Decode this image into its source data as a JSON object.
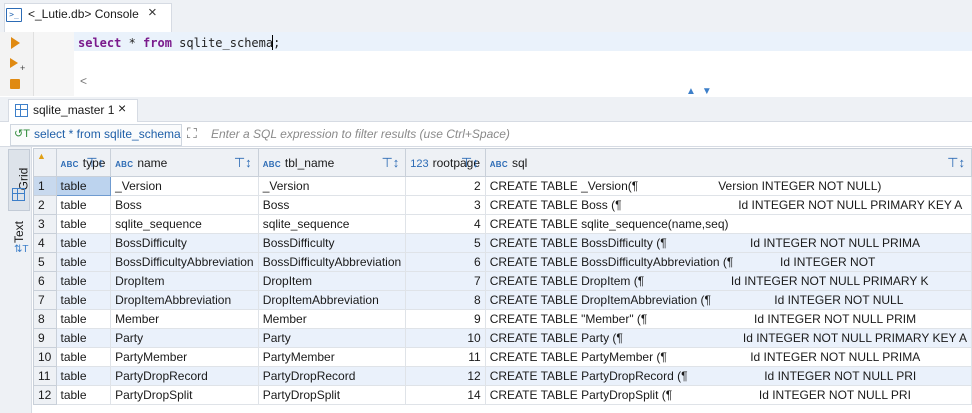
{
  "editor_tab": {
    "title": "<_Lutie.db> Console",
    "close": "×"
  },
  "editor": {
    "sql_keyword1": "select",
    "sql_middle": " * ",
    "sql_keyword2": "from",
    "sql_rest": " sqlite_schema;",
    "scroll_left": "<"
  },
  "results_tab": {
    "title": "sqlite_master 1",
    "close": "×"
  },
  "filter": {
    "query": "select * from sqlite_schema",
    "placeholder": "Enter a SQL expression to filter results (use Ctrl+Space)"
  },
  "side_panel": {
    "grid": "Grid",
    "text": "Text"
  },
  "columns": [
    {
      "badge": "ABC",
      "name": "type"
    },
    {
      "badge": "ABC",
      "name": "name"
    },
    {
      "badge": "ABC",
      "name": "tbl_name"
    },
    {
      "badge": "123",
      "name": "rootpage"
    },
    {
      "badge": "ABC",
      "name": "sql"
    }
  ],
  "rows": [
    {
      "num": "1",
      "type": "table",
      "name": "_Version",
      "tbl_name": "_Version",
      "rootpage": "2",
      "sql": "CREATE TABLE _Version(¶                        Version INTEGER NOT NULL)"
    },
    {
      "num": "2",
      "type": "table",
      "name": "Boss",
      "tbl_name": "Boss",
      "rootpage": "3",
      "sql": "CREATE TABLE Boss (¶                                   Id INTEGER NOT NULL PRIMARY KEY A"
    },
    {
      "num": "3",
      "type": "table",
      "name": "sqlite_sequence",
      "tbl_name": "sqlite_sequence",
      "rootpage": "4",
      "sql": "CREATE TABLE sqlite_sequence(name,seq)"
    },
    {
      "num": "4",
      "type": "table",
      "name": "BossDifficulty",
      "tbl_name": "BossDifficulty",
      "rootpage": "5",
      "sql": "CREATE TABLE BossDifficulty (¶                         Id INTEGER NOT NULL PRIMA"
    },
    {
      "num": "5",
      "type": "table",
      "name": "BossDifficultyAbbreviation",
      "tbl_name": "BossDifficultyAbbreviation",
      "rootpage": "6",
      "sql": "CREATE TABLE BossDifficultyAbbreviation (¶              Id INTEGER NOT"
    },
    {
      "num": "6",
      "type": "table",
      "name": "DropItem",
      "tbl_name": "DropItem",
      "rootpage": "7",
      "sql": "CREATE TABLE DropItem (¶                          Id INTEGER NOT NULL PRIMARY K"
    },
    {
      "num": "7",
      "type": "table",
      "name": "DropItemAbbreviation",
      "tbl_name": "DropItemAbbreviation",
      "rootpage": "8",
      "sql": "CREATE TABLE DropItemAbbreviation (¶                   Id INTEGER NOT NULL"
    },
    {
      "num": "8",
      "type": "table",
      "name": "Member",
      "tbl_name": "Member",
      "rootpage": "9",
      "sql": "CREATE TABLE \"Member\" (¶                                Id INTEGER NOT NULL PRIM"
    },
    {
      "num": "9",
      "type": "table",
      "name": "Party",
      "tbl_name": "Party",
      "rootpage": "10",
      "sql": "CREATE TABLE Party (¶                                    Id INTEGER NOT NULL PRIMARY KEY A"
    },
    {
      "num": "10",
      "type": "table",
      "name": "PartyMember",
      "tbl_name": "PartyMember",
      "rootpage": "11",
      "sql": "CREATE TABLE PartyMember (¶                         Id INTEGER NOT NULL PRIMA"
    },
    {
      "num": "11",
      "type": "table",
      "name": "PartyDropRecord",
      "tbl_name": "PartyDropRecord",
      "rootpage": "12",
      "sql": "CREATE TABLE PartyDropRecord (¶                       Id INTEGER NOT NULL PRI"
    },
    {
      "num": "12",
      "type": "table",
      "name": "PartyDropSplit",
      "tbl_name": "PartyDropSplit",
      "rootpage": "14",
      "sql": "CREATE TABLE PartyDropSplit (¶                          Id INTEGER NOT NULL PRI"
    }
  ]
}
